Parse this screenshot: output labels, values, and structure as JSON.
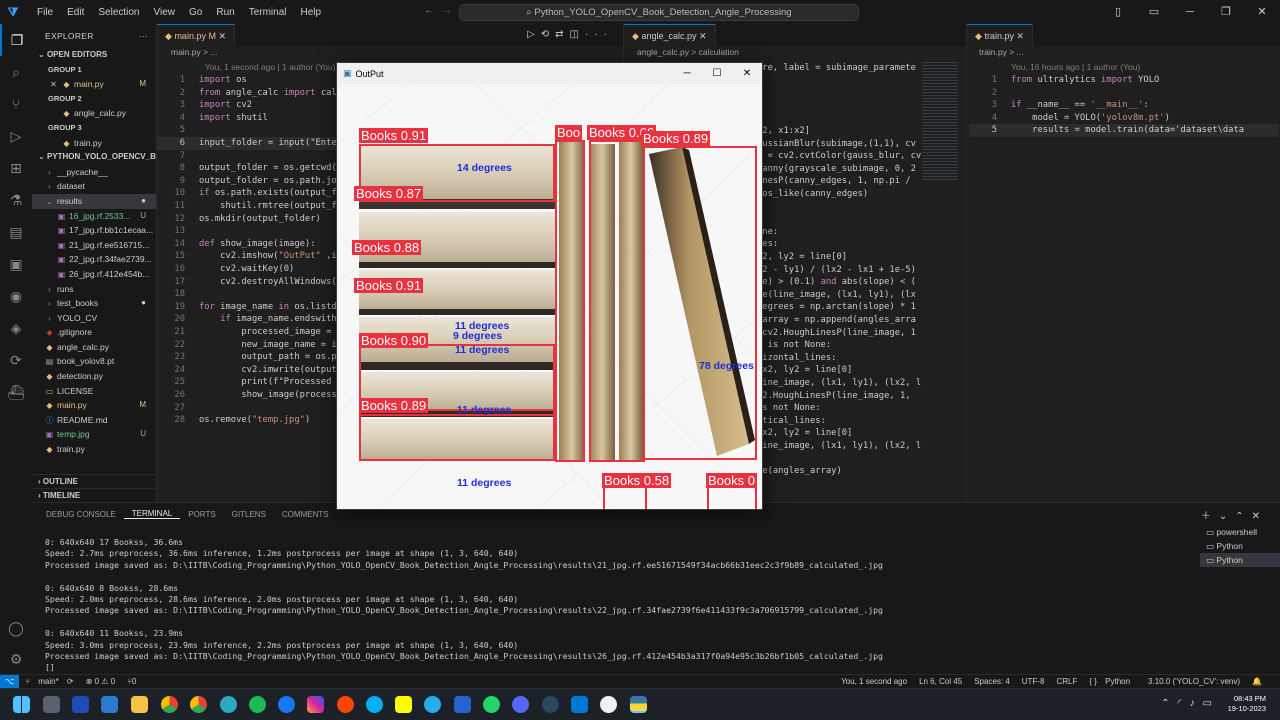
{
  "titlebar": {
    "menu": [
      "File",
      "Edit",
      "Selection",
      "View",
      "Go",
      "Run",
      "Terminal",
      "Help"
    ],
    "command_center": "Python_YOLO_OpenCV_Book_Detection_Angle_Processing"
  },
  "explorer": {
    "header": "EXPLORER",
    "open_editors_header": "OPEN EDITORS",
    "groups": [
      {
        "label": "GROUP 1",
        "file": "main.py",
        "badge": "M"
      },
      {
        "label": "GROUP 2",
        "file": "angle_calc.py",
        "badge": ""
      },
      {
        "label": "GROUP 3",
        "file": "train.py",
        "badge": ""
      }
    ],
    "project_header": "PYTHON_YOLO_OPENCV_BOO...",
    "tree": [
      {
        "name": "__pycache__",
        "kind": "folder",
        "indent": 1,
        "badge": ""
      },
      {
        "name": "dataset",
        "kind": "folder",
        "indent": 1,
        "badge": ""
      },
      {
        "name": "results",
        "kind": "folder-open",
        "indent": 1,
        "badge": "●"
      },
      {
        "name": "16_jpg.rf.2533...",
        "kind": "image",
        "indent": 2,
        "badge": "U"
      },
      {
        "name": "17_jpg.rf.bb1c1ecaa...",
        "kind": "image",
        "indent": 2,
        "badge": ""
      },
      {
        "name": "21_jpg.rf.ee516715...",
        "kind": "image",
        "indent": 2,
        "badge": ""
      },
      {
        "name": "22_jpg.rf.34fae2739...",
        "kind": "image",
        "indent": 2,
        "badge": ""
      },
      {
        "name": "26_jpg.rf.412e454b...",
        "kind": "image",
        "indent": 2,
        "badge": ""
      },
      {
        "name": "runs",
        "kind": "folder",
        "indent": 1,
        "badge": ""
      },
      {
        "name": "test_books",
        "kind": "folder",
        "indent": 1,
        "badge": "●"
      },
      {
        "name": "YOLO_CV",
        "kind": "folder",
        "indent": 1,
        "badge": ""
      },
      {
        "name": ".gitignore",
        "kind": "git",
        "indent": 1,
        "badge": ""
      },
      {
        "name": "angle_calc.py",
        "kind": "py",
        "indent": 1,
        "badge": ""
      },
      {
        "name": "book_yolov8.pt",
        "kind": "file",
        "indent": 1,
        "badge": ""
      },
      {
        "name": "detection.py",
        "kind": "py",
        "indent": 1,
        "badge": ""
      },
      {
        "name": "LICENSE",
        "kind": "license",
        "indent": 1,
        "badge": ""
      },
      {
        "name": "main.py",
        "kind": "py",
        "indent": 1,
        "badge": "M"
      },
      {
        "name": "README.md",
        "kind": "md",
        "indent": 1,
        "badge": ""
      },
      {
        "name": "temp.jpg",
        "kind": "image",
        "indent": 1,
        "badge": "U"
      },
      {
        "name": "train.py",
        "kind": "py",
        "indent": 1,
        "badge": ""
      }
    ],
    "outline": "OUTLINE",
    "timeline": "TIMELINE"
  },
  "editor1": {
    "tab": "main.py",
    "tab_badge": "M",
    "breadcrumb": "main.py > ...",
    "blame": "You, 1 second ago | 1 author (You)",
    "lines": [
      "import os",
      "from angle_calc import cal",
      "import cv2",
      "import shutil",
      "",
      "input_folder = input(\"Ente",
      "",
      "output_folder = os.getcwd(",
      "output_folder = os.path.jo",
      "if os.path.exists(output_f",
      "    shutil.rmtree(output_f",
      "os.mkdir(output_folder)",
      "",
      "def show_image(image):",
      "    cv2.imshow(\"OutPut\" ,i",
      "    cv2.waitKey(0)",
      "    cv2.destroyAllWindows(",
      "",
      "for image_name in os.listd",
      "    if image_name.endswith",
      "        processed_image = ",
      "        new_image_name = i",
      "        output_path = os.p",
      "        cv2.imwrite(output",
      "        print(f\"Processed ",
      "        show_image(process",
      "",
      "os.remove(\"temp.jpg\")"
    ]
  },
  "editor2": {
    "tab": "angle_calc.py",
    "breadcrumb": "angle_calc.py > calculation",
    "lines": [
      "ore, label = subimage_paramete",
      ")",
      ")",
      ")",
      ")",
      "y2, x1:x2]",
      "aussianBlur(subimage,(1,1), cv",
      "e = cv2.cvtColor(gauss_blur, cv",
      "Canny(grayscale_subimage, 0, 2",
      "inesP(canny_edges, 1, np.pi /",
      "ros_like(canny_edges)",
      "",
      "",
      "one:",
      "nes:",
      "x2, ly2 = line[0]",
      "y2 - ly1) / (lx2 - lx1 + 1e-5)",
      "pe) > (0.1) and abs(slope) < (",
      "ne(line_image, (lx1, ly1), (lx",
      "degrees = np.arctan(slope) * 1",
      "_array = np.append(angles_arra",
      " cv2.HoughLinesP(line_image, 1",
      "s is not None:",
      "rizontal_lines:",
      "lx2, ly2 = line[0]",
      "line_image, (lx1, ly1), (lx2, l",
      "v2.HoughLinesP(line_image, 1,",
      "is not None:",
      "rtical_lines:",
      "lx2, ly2 = line[0]",
      "line_image, (lx1, ly1), (lx2, l",
      "",
      "de(angles_array)"
    ]
  },
  "editor3": {
    "tab": "train.py",
    "breadcrumb": "train.py > ...",
    "blame": "You, 16 hours ago | 1 author (You)",
    "lines": [
      "from ultralytics import YOLO",
      "",
      "if __name__ == '__main__':",
      "    model = YOLO('yolov8m.pt')",
      "    results = model.train(data='dataset\\data"
    ]
  },
  "popup": {
    "title": "OutPut",
    "boxes": [
      {
        "label": "Books 0.91",
        "angle": "14 degrees"
      },
      {
        "label": "Books 0.87",
        "angle": ""
      },
      {
        "label": "Books 0.88",
        "angle": ""
      },
      {
        "label": "Books 0.91",
        "angle": "11 degrees"
      },
      {
        "label": "Books 0.90",
        "angle": "9 degrees"
      },
      {
        "label": "Books 0.89",
        "angle": "11 degrees"
      },
      {
        "label": "Books 0.66",
        "angle": ""
      },
      {
        "label": "Books 0.89",
        "angle": "78 degrees"
      },
      {
        "label": "Books 0.58",
        "angle": ""
      },
      {
        "label": "Books 0",
        "angle": ""
      },
      {
        "label": "Boo",
        "angle": ""
      }
    ],
    "extra_angles": [
      "11 degrees",
      "11 degrees"
    ]
  },
  "panel": {
    "tabs": [
      "DEBUG CONSOLE",
      "TERMINAL",
      "PORTS",
      "GITLENS",
      "COMMENTS"
    ],
    "active_tab": "TERMINAL",
    "lines": [
      "0: 640x640 17 Bookss, 36.6ms",
      "Speed: 2.7ms preprocess, 36.6ms inference, 1.2ms postprocess per image at shape (1, 3, 640, 640)",
      "Processed image saved as: D:\\IITB\\Coding_Programming\\Python_YOLO_OpenCV_Book_Detection_Angle_Processing\\results\\21_jpg.rf.ee51671549f34acb66b31eec2c3f9b89_calculated_.jpg",
      "",
      "0: 640x640 8 Bookss, 28.6ms",
      "Speed: 2.0ms preprocess, 28.6ms inference, 2.0ms postprocess per image at shape (1, 3, 640, 640)",
      "Processed image saved as: D:\\IITB\\Coding_Programming\\Python_YOLO_OpenCV_Book_Detection_Angle_Processing\\results\\22_jpg.rf.34fae2739f6e411433f9c3a706915799_calculated_.jpg",
      "",
      "0: 640x640 11 Bookss, 23.9ms",
      "Speed: 3.0ms preprocess, 23.9ms inference, 2.2ms postprocess per image at shape (1, 3, 640, 640)",
      "Processed image saved as: D:\\IITB\\Coding_Programming\\Python_YOLO_OpenCV_Book_Detection_Angle_Processing\\results\\26_jpg.rf.412e454b3a317f0a94e95c3b26bf1b05_calculated_.jpg",
      "[]"
    ],
    "terminals": [
      "powershell",
      "Python",
      "Python"
    ]
  },
  "statusbar": {
    "branch": "main*",
    "errors": "⊗ 0 ⚠ 0",
    "ports": "⑂0",
    "blame": "You, 1 second ago",
    "position": "Ln 6, Col 45",
    "spaces": "Spaces: 4",
    "encoding": "UTF-8",
    "eol": "CRLF",
    "language": "Python",
    "interpreter": "3.10.0 ('YOLO_CV': venv)"
  },
  "taskbar": {
    "time": "08:43 PM",
    "date": "19-10-2023"
  },
  "colors": {
    "accent": "#0078d4",
    "box": "#e8323f",
    "angle_text": "#1f2fd8"
  }
}
